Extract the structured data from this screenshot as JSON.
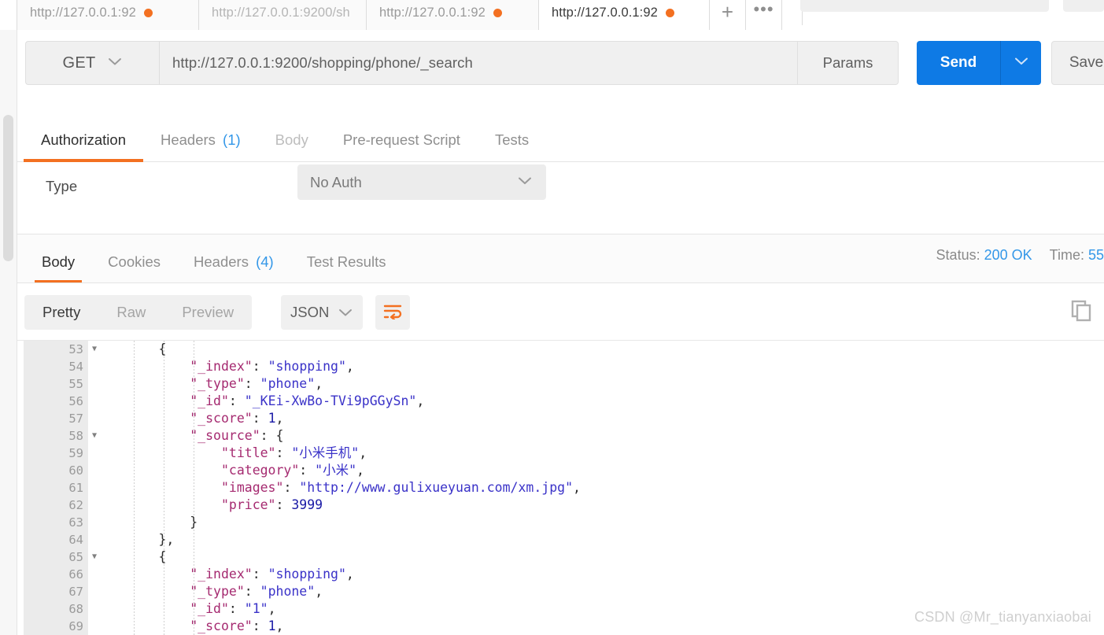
{
  "tabs": {
    "items": [
      {
        "label": "http://127.0.0.1:92",
        "unsaved": true,
        "active": false,
        "truncated": false
      },
      {
        "label": "http://127.0.0.1:9200/sh",
        "unsaved": false,
        "active": false,
        "truncated": true
      },
      {
        "label": "http://127.0.0.1:92",
        "unsaved": true,
        "active": false,
        "truncated": false
      },
      {
        "label": "http://127.0.0.1:92",
        "unsaved": true,
        "active": true,
        "truncated": false
      }
    ],
    "new_tab_label": "+",
    "more_label": "•••"
  },
  "request": {
    "method": "GET",
    "url": "http://127.0.0.1:9200/shopping/phone/_search",
    "params_label": "Params",
    "send_label": "Send",
    "save_label": "Save",
    "tabs": [
      {
        "label": "Authorization",
        "active": true,
        "dim": false,
        "count": ""
      },
      {
        "label": "Headers",
        "active": false,
        "dim": false,
        "count": "(1)"
      },
      {
        "label": "Body",
        "active": false,
        "dim": true,
        "count": ""
      },
      {
        "label": "Pre-request Script",
        "active": false,
        "dim": false,
        "count": ""
      },
      {
        "label": "Tests",
        "active": false,
        "dim": false,
        "count": ""
      }
    ]
  },
  "authorization": {
    "type_label": "Type",
    "type_value": "No Auth"
  },
  "response": {
    "tabs": [
      {
        "label": "Body",
        "active": true,
        "count": ""
      },
      {
        "label": "Cookies",
        "active": false,
        "count": ""
      },
      {
        "label": "Headers",
        "active": false,
        "count": "(4)"
      },
      {
        "label": "Test Results",
        "active": false,
        "count": ""
      }
    ],
    "status_label": "Status:",
    "status_value": "200 OK",
    "time_label": "Time:",
    "time_value": "55",
    "view_modes": [
      {
        "label": "Pretty",
        "active": true
      },
      {
        "label": "Raw",
        "active": false
      },
      {
        "label": "Preview",
        "active": false
      }
    ],
    "format": "JSON"
  },
  "colors": {
    "accent_orange": "#f37021",
    "accent_blue": "#0e7ae5",
    "link_blue": "#3397e8",
    "key_purple": "#a52a70",
    "string_blue": "#3a32c8"
  },
  "code": {
    "first_line_number": 53,
    "lines": [
      {
        "num": 53,
        "fold": true,
        "indent": 2,
        "tokens": [
          {
            "t": "{",
            "c": "p"
          }
        ]
      },
      {
        "num": 54,
        "fold": false,
        "indent": 3,
        "tokens": [
          {
            "t": "\"_index\"",
            "c": "k"
          },
          {
            "t": ": ",
            "c": "p"
          },
          {
            "t": "\"shopping\"",
            "c": "s"
          },
          {
            "t": ",",
            "c": "p"
          }
        ]
      },
      {
        "num": 55,
        "fold": false,
        "indent": 3,
        "tokens": [
          {
            "t": "\"_type\"",
            "c": "k"
          },
          {
            "t": ": ",
            "c": "p"
          },
          {
            "t": "\"phone\"",
            "c": "s"
          },
          {
            "t": ",",
            "c": "p"
          }
        ]
      },
      {
        "num": 56,
        "fold": false,
        "indent": 3,
        "tokens": [
          {
            "t": "\"_id\"",
            "c": "k"
          },
          {
            "t": ": ",
            "c": "p"
          },
          {
            "t": "\"_KEi-XwBo-TVi9pGGySn\"",
            "c": "s"
          },
          {
            "t": ",",
            "c": "p"
          }
        ]
      },
      {
        "num": 57,
        "fold": false,
        "indent": 3,
        "tokens": [
          {
            "t": "\"_score\"",
            "c": "k"
          },
          {
            "t": ": ",
            "c": "p"
          },
          {
            "t": "1",
            "c": "n"
          },
          {
            "t": ",",
            "c": "p"
          }
        ]
      },
      {
        "num": 58,
        "fold": true,
        "indent": 3,
        "tokens": [
          {
            "t": "\"_source\"",
            "c": "k"
          },
          {
            "t": ": {",
            "c": "p"
          }
        ]
      },
      {
        "num": 59,
        "fold": false,
        "indent": 4,
        "tokens": [
          {
            "t": "\"title\"",
            "c": "k"
          },
          {
            "t": ": ",
            "c": "p"
          },
          {
            "t": "\"小米手机\"",
            "c": "s"
          },
          {
            "t": ",",
            "c": "p"
          }
        ]
      },
      {
        "num": 60,
        "fold": false,
        "indent": 4,
        "tokens": [
          {
            "t": "\"category\"",
            "c": "k"
          },
          {
            "t": ": ",
            "c": "p"
          },
          {
            "t": "\"小米\"",
            "c": "s"
          },
          {
            "t": ",",
            "c": "p"
          }
        ]
      },
      {
        "num": 61,
        "fold": false,
        "indent": 4,
        "tokens": [
          {
            "t": "\"images\"",
            "c": "k"
          },
          {
            "t": ": ",
            "c": "p"
          },
          {
            "t": "\"http://www.gulixueyuan.com/xm.jpg\"",
            "c": "s"
          },
          {
            "t": ",",
            "c": "p"
          }
        ]
      },
      {
        "num": 62,
        "fold": false,
        "indent": 4,
        "tokens": [
          {
            "t": "\"price\"",
            "c": "k"
          },
          {
            "t": ": ",
            "c": "p"
          },
          {
            "t": "3999",
            "c": "n"
          }
        ]
      },
      {
        "num": 63,
        "fold": false,
        "indent": 3,
        "tokens": [
          {
            "t": "}",
            "c": "p"
          }
        ]
      },
      {
        "num": 64,
        "fold": false,
        "indent": 2,
        "tokens": [
          {
            "t": "},",
            "c": "p"
          }
        ]
      },
      {
        "num": 65,
        "fold": true,
        "indent": 2,
        "tokens": [
          {
            "t": "{",
            "c": "p"
          }
        ]
      },
      {
        "num": 66,
        "fold": false,
        "indent": 3,
        "tokens": [
          {
            "t": "\"_index\"",
            "c": "k"
          },
          {
            "t": ": ",
            "c": "p"
          },
          {
            "t": "\"shopping\"",
            "c": "s"
          },
          {
            "t": ",",
            "c": "p"
          }
        ]
      },
      {
        "num": 67,
        "fold": false,
        "indent": 3,
        "tokens": [
          {
            "t": "\"_type\"",
            "c": "k"
          },
          {
            "t": ": ",
            "c": "p"
          },
          {
            "t": "\"phone\"",
            "c": "s"
          },
          {
            "t": ",",
            "c": "p"
          }
        ]
      },
      {
        "num": 68,
        "fold": false,
        "indent": 3,
        "tokens": [
          {
            "t": "\"_id\"",
            "c": "k"
          },
          {
            "t": ": ",
            "c": "p"
          },
          {
            "t": "\"1\"",
            "c": "s"
          },
          {
            "t": ",",
            "c": "p"
          }
        ]
      },
      {
        "num": 69,
        "fold": false,
        "indent": 3,
        "tokens": [
          {
            "t": "\"_score\"",
            "c": "k"
          },
          {
            "t": ": ",
            "c": "p"
          },
          {
            "t": "1",
            "c": "n"
          },
          {
            "t": ",",
            "c": "p"
          }
        ]
      }
    ]
  },
  "watermark": "CSDN @Mr_tianyanxiaobai"
}
